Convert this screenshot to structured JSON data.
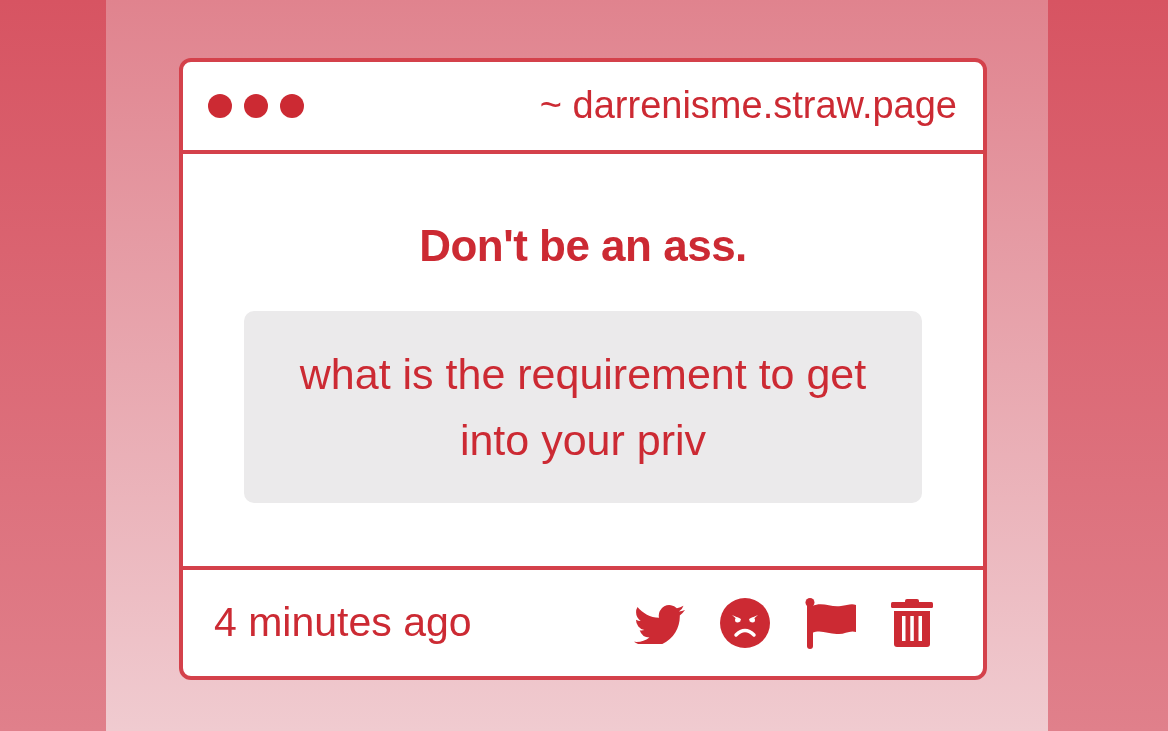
{
  "window": {
    "address": "~ darrenisme.straw.page"
  },
  "message": {
    "title": "Don't be an ass.",
    "text": "what is the requirement to get into your priv"
  },
  "footer": {
    "time": "4 minutes ago",
    "actions": [
      {
        "kind": "bird"
      },
      {
        "kind": "angry"
      },
      {
        "kind": "flag"
      },
      {
        "kind": "trash"
      }
    ]
  }
}
